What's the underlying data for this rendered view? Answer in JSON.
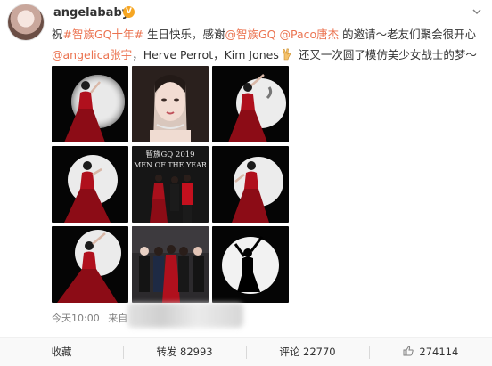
{
  "user": {
    "name": "angelababy",
    "badge": "V"
  },
  "post": {
    "line1": {
      "prefix": "祝",
      "tag": "#智族GQ十年#",
      "text1": " 生日快乐，感谢",
      "mention1": "@智族GQ",
      "space": " ",
      "mention2": "@Paco唐杰",
      "text2": " 的邀请～老友们聚会很开心"
    },
    "line2": {
      "mention3": "@angelica张宇",
      "text1": "，Herve Perrot，Kim Jones",
      "text2": " 还又一次圆了模仿美少女战士的梦～"
    }
  },
  "photos": {
    "poster_title": "智族GQ 2019",
    "poster_sub": "MEN OF THE YEAR"
  },
  "meta": {
    "time": "今天10:00",
    "source_prefix": "来自"
  },
  "toolbar": {
    "favorite": "收藏",
    "repost_label": "转发",
    "repost_count": "82993",
    "comment_label": "评论",
    "comment_count": "22770",
    "like_count": "274114"
  },
  "colors": {
    "link": "#eb7350",
    "text": "#333333",
    "muted": "#808080",
    "dress_red": "#b0101d"
  }
}
